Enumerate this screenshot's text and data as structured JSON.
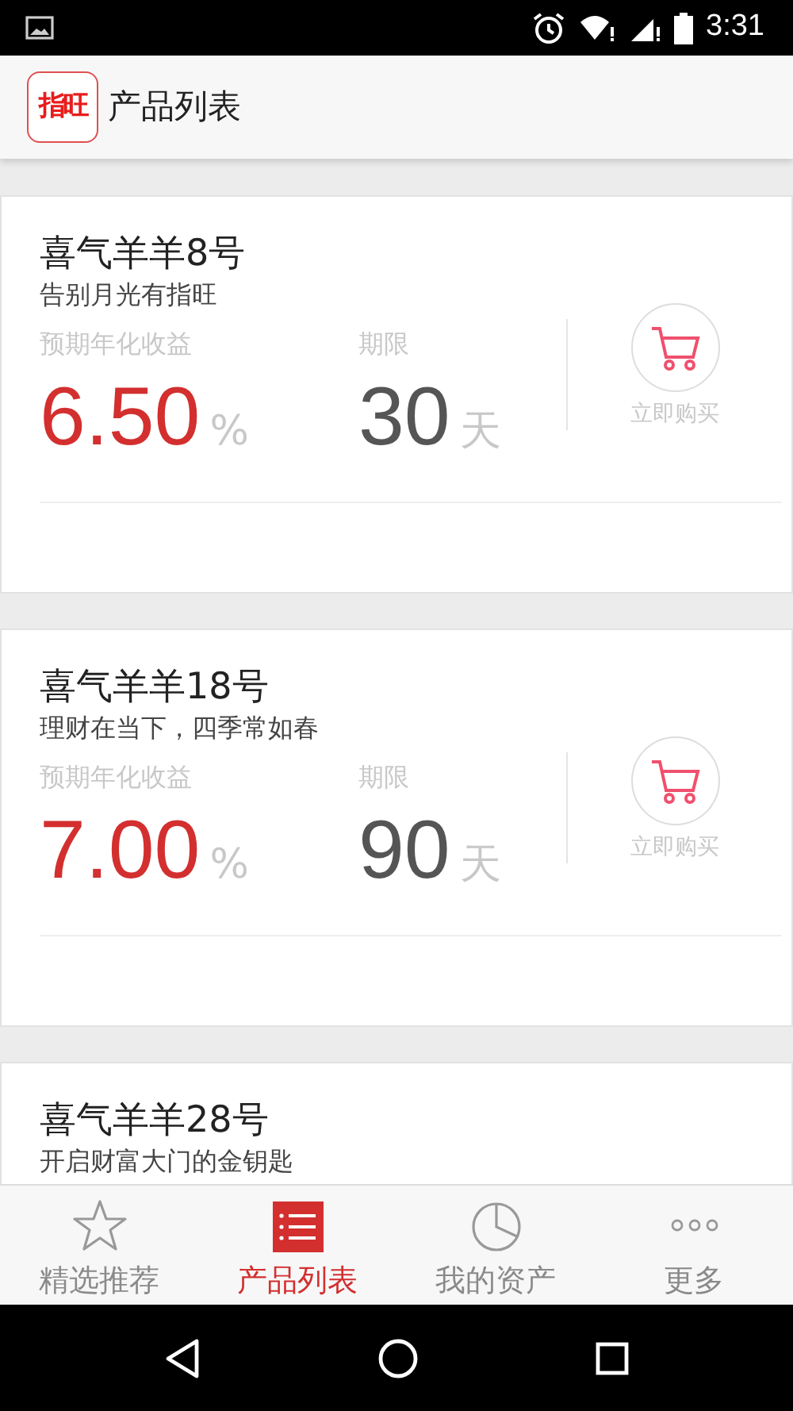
{
  "status_bar": {
    "time": "3:31"
  },
  "app_bar": {
    "logo": "指旺",
    "title": "产品列表"
  },
  "products": [
    {
      "name": "喜气羊羊8号",
      "slogan": "告别月光有指旺",
      "rate_label": "预期年化收益",
      "rate": "6.50",
      "rate_unit": "%",
      "term_label": "期限",
      "term": "30",
      "term_unit": "天",
      "buy_label": "立即购买"
    },
    {
      "name": "喜气羊羊18号",
      "slogan": "理财在当下，四季常如春",
      "rate_label": "预期年化收益",
      "rate": "7.00",
      "rate_unit": "%",
      "term_label": "期限",
      "term": "90",
      "term_unit": "天",
      "buy_label": "立即购买"
    },
    {
      "name": "喜气羊羊28号",
      "slogan": "开启财富大门的金钥匙"
    }
  ],
  "tabs": [
    {
      "label": "精选推荐",
      "selected": false,
      "kind": "star"
    },
    {
      "label": "产品列表",
      "selected": true,
      "kind": "list"
    },
    {
      "label": "我的资产",
      "selected": false,
      "kind": "pie"
    },
    {
      "label": "更多",
      "selected": false,
      "kind": "more"
    }
  ]
}
